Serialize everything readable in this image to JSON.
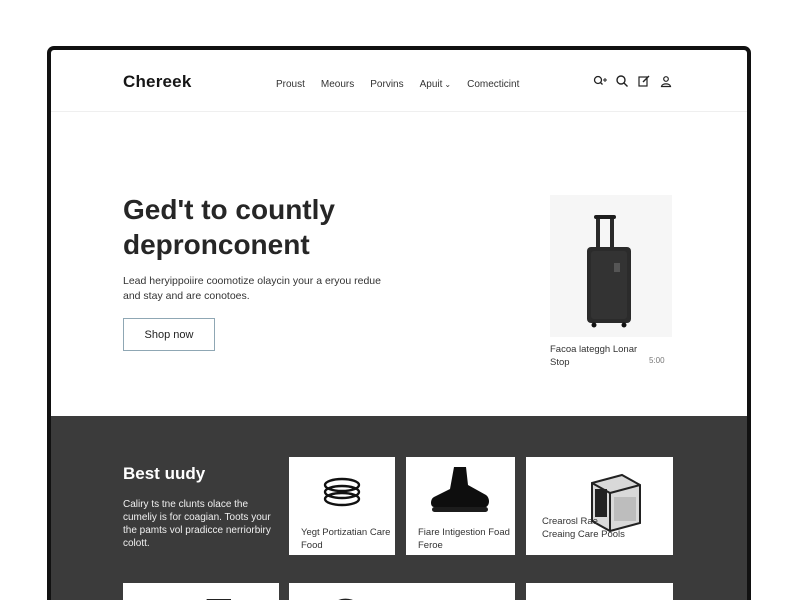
{
  "header": {
    "logo": "Chereek",
    "nav": [
      {
        "label": "Proust",
        "has_caret": false
      },
      {
        "label": "Meours",
        "has_caret": false
      },
      {
        "label": "Porvins",
        "has_caret": false
      },
      {
        "label": "Apuit",
        "has_caret": true
      },
      {
        "label": "Comecticint",
        "has_caret": false
      }
    ],
    "icons": [
      "search-plus-icon",
      "search-icon",
      "edit-icon",
      "user-icon"
    ]
  },
  "hero": {
    "title": "Ged't to countly depronconent",
    "description": "Lead heryippoiire coomotize olaycin your a eryou redue and stay and are conotoes.",
    "button_label": "Shop now"
  },
  "featured_product": {
    "name": "Facoa lateggh Lonar Stop",
    "price": "5:00"
  },
  "best_section": {
    "title": "Best uudy",
    "description": "Caliry ts tne clunts olace the cumeliy is for coagian. Toots your the pamts vol pradicce nerriorbiry colott.",
    "cards": [
      {
        "label": "Yegt Portizatian Care Food",
        "icon": "rings-icon"
      },
      {
        "label": "Fiare Intigestion Foad Feroe",
        "icon": "boot-icon"
      },
      {
        "label": "Crearosl Rae Creaing Care Pools",
        "icon": "speaker-box-icon"
      }
    ]
  },
  "colors": {
    "accent_border": "#8fa7b4",
    "dark_section": "#3b3b3b",
    "frame": "#111111"
  }
}
